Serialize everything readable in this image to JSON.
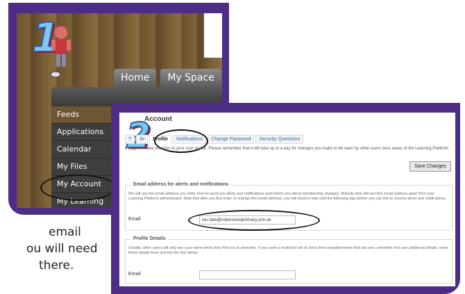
{
  "panel1": {
    "step_number": "1",
    "tabs": [
      "Home",
      "My Space"
    ],
    "menu": [
      "Feeds",
      "Applications",
      "Calendar",
      "My Files",
      "My Account",
      "My Learning"
    ],
    "active_menu_index": 0,
    "highlighted_item": "My Account"
  },
  "caption": {
    "lines": [
      "email",
      "ou will need",
      "there."
    ]
  },
  "panel2": {
    "step_number": "2",
    "title": "Account",
    "tabs": [
      "T",
      "ile",
      "Profile",
      "Notifications",
      "Change Password",
      "Security Questions"
    ],
    "active_tab": "Profile",
    "intro": "e page to make changes to your user profile. Please remember that it will take up to a day for changes you make to be seen by other users rious areas of the Learning Platform.",
    "save_label": "Save Changes",
    "email_section": {
      "legend": "Email address for alerts and notifications",
      "text": "We will use the email address you enter here to send you alerts and notifications and inform you about membership changes. Nobody else will see this email address apart from your Learning Platform administrator. Note that after you first enter or change this email address, you will need to wait until the following day before you can link to receive alerts and notifications.",
      "label": "Email",
      "value": "lou.tate@robinsnestprimary.sch.uk"
    },
    "profile_section": {
      "legend": "Profile Details",
      "text": "Usually, other users will only see your name when they find you in searches. If you want a restricted set of users from establishments that you are a member of to see additional details, enter these details here and tick the box below.",
      "label": "Email",
      "value": ""
    }
  },
  "colors": {
    "frame": "#4e2d86",
    "number_fill": "#7fc7ef",
    "number_shadow": "#9e1c20"
  }
}
